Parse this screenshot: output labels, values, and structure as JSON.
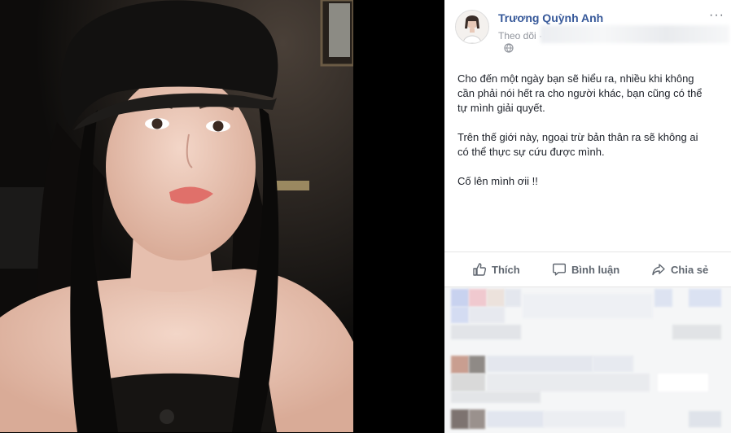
{
  "post": {
    "author": "Trương Quỳnh Anh",
    "follow_label": "Theo dõi",
    "separator": "·",
    "more_label": "···",
    "paragraphs": [
      "Cho đến một ngày bạn sẽ hiểu ra, nhiều khi không\ncần phải nói hết ra cho người khác, bạn cũng có thể\ntự mình giải quyết.",
      "Trên thế giới này, ngoại trừ bản thân ra sẽ không ai\ncó thể thực sự cứu được mình.",
      "Cố lên mình ơii !!"
    ]
  },
  "actions": {
    "like": "Thích",
    "comment": "Bình luận",
    "share": "Chia sẻ"
  },
  "icons": [
    "globe-icon",
    "thumbs-up-icon",
    "comment-icon",
    "share-icon",
    "more-options-icon"
  ],
  "colors": {
    "author_link": "#365899",
    "meta_text": "#90949c",
    "action_text": "#606770",
    "body_text": "#1d2129",
    "comment_bg": "#f5f6f7"
  }
}
